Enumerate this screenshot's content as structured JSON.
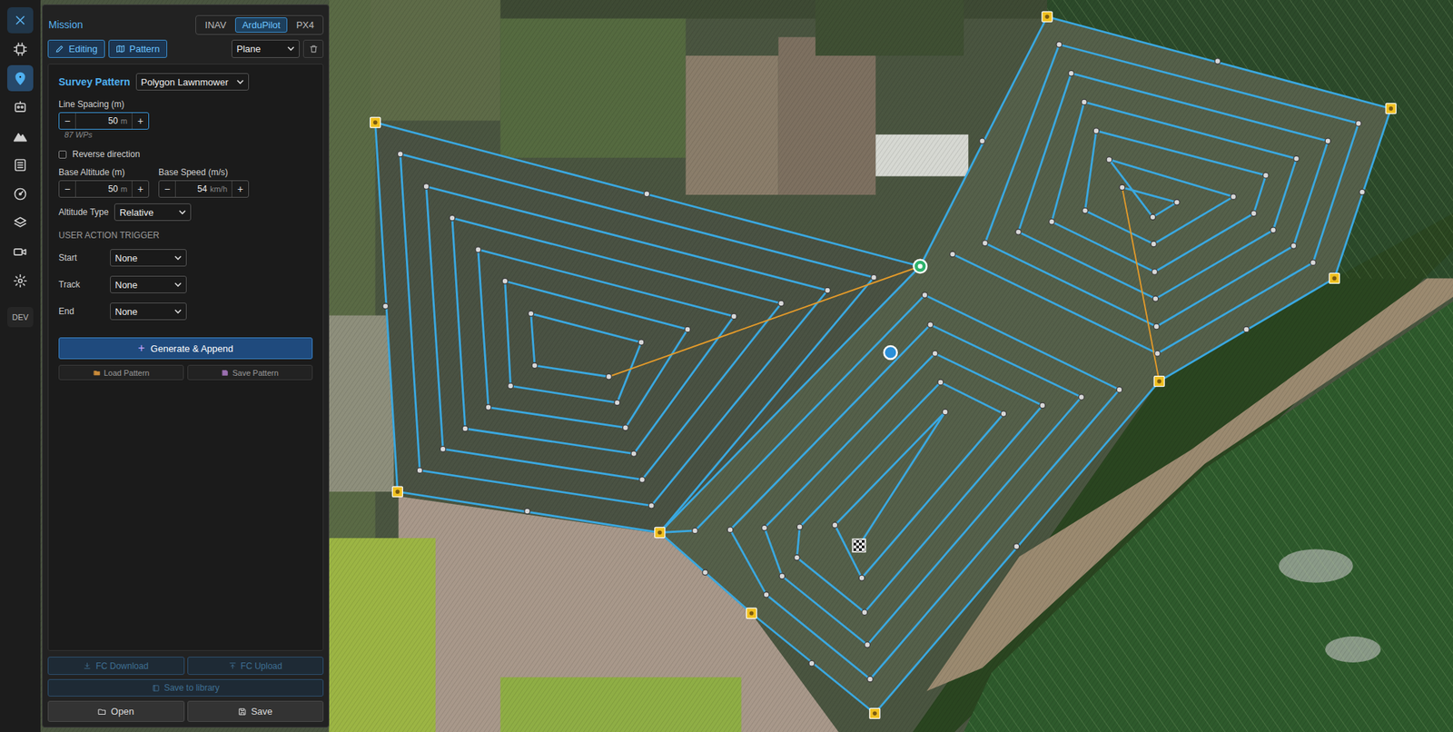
{
  "sidebar": {
    "items": [
      {
        "selected": false
      },
      {
        "selected": true
      },
      {
        "selected": false
      },
      {
        "selected": false
      },
      {
        "selected": false
      },
      {
        "selected": false
      },
      {
        "selected": false
      },
      {
        "selected": false
      },
      {
        "selected": false
      }
    ],
    "dev": "DEV"
  },
  "panel": {
    "title": "Mission",
    "firmware_tabs": [
      {
        "label": "INAV",
        "selected": false
      },
      {
        "label": "ArduPilot",
        "selected": true
      },
      {
        "label": "PX4",
        "selected": false
      }
    ],
    "mode_buttons": [
      {
        "label": "Editing",
        "selected": true
      },
      {
        "label": "Pattern",
        "selected": true
      }
    ],
    "vehicle": "Plane",
    "survey": {
      "label": "Survey Pattern",
      "type": "Polygon Lawnmower"
    },
    "line_spacing": {
      "label": "Line Spacing (m)",
      "minus": "−",
      "value": "50",
      "unit": "m",
      "plus": "+",
      "focused": true
    },
    "waypoint_count": "87 WPs",
    "reverse": {
      "label": "Reverse direction",
      "checked": false
    },
    "base_altitude": {
      "label": "Base Altitude (m)",
      "minus": "−",
      "value": "50",
      "unit": "m",
      "plus": "+",
      "focused": false
    },
    "base_speed": {
      "label": "Base Speed (m/s)",
      "minus": "−",
      "value": "54",
      "unit": "km/h",
      "plus": "+",
      "focused": false
    },
    "altitude_type": {
      "label": "Altitude Type",
      "value": "Relative"
    },
    "trigger": {
      "title": "USER ACTION TRIGGER",
      "rows": [
        {
          "label": "Start",
          "value": "None"
        },
        {
          "label": "Track",
          "value": "None"
        },
        {
          "label": "End",
          "value": "None"
        }
      ]
    },
    "generate": {
      "icon": "+",
      "label": "Generate & Append"
    },
    "pattern_files": [
      {
        "label": "Load Pattern"
      },
      {
        "label": "Save Pattern"
      }
    ],
    "fc_buttons": [
      {
        "label": "FC Download",
        "disabled": true
      },
      {
        "label": "FC Upload",
        "disabled": true
      }
    ],
    "library": {
      "label": "Save to library",
      "disabled": true
    },
    "file_buttons": [
      {
        "label": "Open"
      },
      {
        "label": "Save"
      }
    ]
  }
}
